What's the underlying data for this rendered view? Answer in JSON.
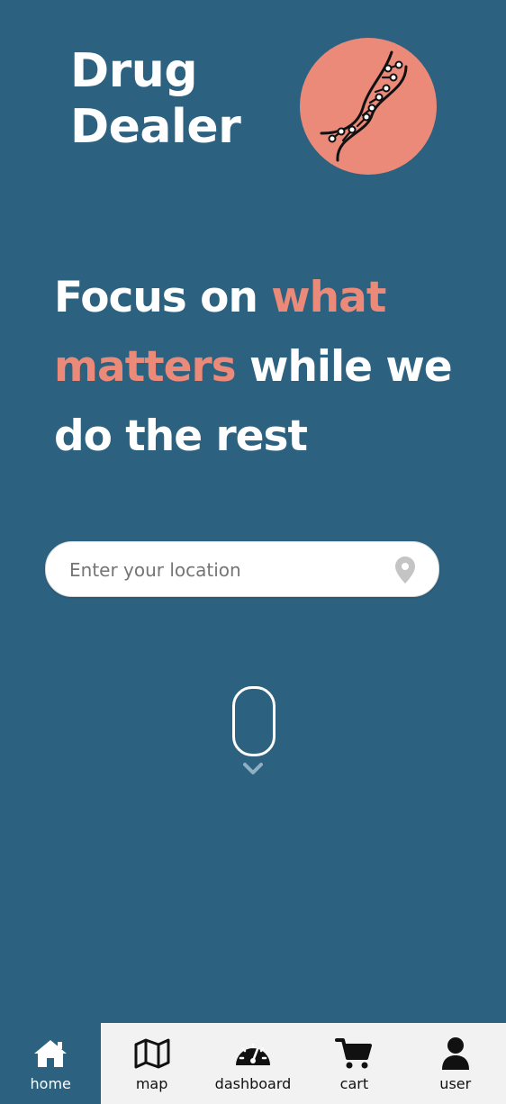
{
  "brand": {
    "title": "Drug\nDealer",
    "logo_icon": "dna-helix-icon",
    "logo_color": "#ec8a7a"
  },
  "hero": {
    "part1": "Focus on ",
    "accent1": "what",
    "part2": " ",
    "accent2": "matters",
    "part3": " while we do the rest",
    "accent_color": "#ec8a7a"
  },
  "search": {
    "placeholder": "Enter your location",
    "value": "",
    "icon": "location-pin-icon"
  },
  "scroll_hint": {
    "icon": "mouse-scroll-icon",
    "chevron": "chevron-down-icon"
  },
  "nav": {
    "items": [
      {
        "label": "home",
        "icon": "home-icon",
        "active": true
      },
      {
        "label": "map",
        "icon": "map-icon",
        "active": false
      },
      {
        "label": "dashboard",
        "icon": "gauge-icon",
        "active": false
      },
      {
        "label": "cart",
        "icon": "cart-icon",
        "active": false
      },
      {
        "label": "user",
        "icon": "user-icon",
        "active": false
      }
    ]
  },
  "colors": {
    "background": "#2c617f",
    "accent": "#ec8a7a",
    "nav_background": "#f2f2f2"
  }
}
